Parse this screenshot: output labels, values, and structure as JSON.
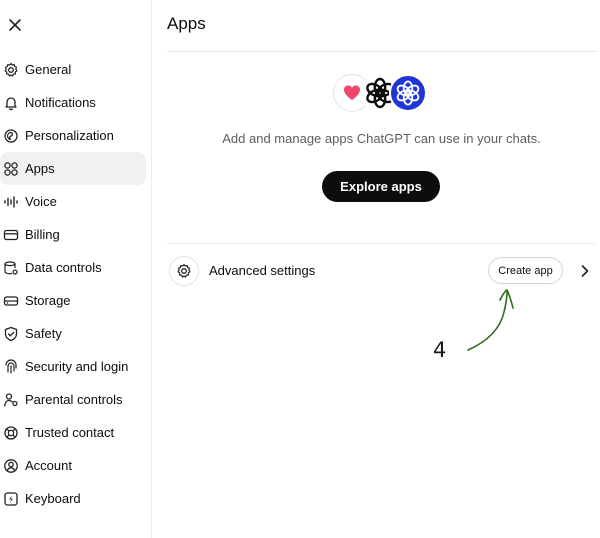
{
  "sidebar": {
    "items": [
      {
        "label": "General",
        "icon": "gear-icon"
      },
      {
        "label": "Notifications",
        "icon": "bell-icon"
      },
      {
        "label": "Personalization",
        "icon": "personalization-icon"
      },
      {
        "label": "Apps",
        "icon": "apps-grid-icon",
        "active": true
      },
      {
        "label": "Voice",
        "icon": "waveform-icon"
      },
      {
        "label": "Billing",
        "icon": "credit-card-icon"
      },
      {
        "label": "Data controls",
        "icon": "database-icon"
      },
      {
        "label": "Storage",
        "icon": "storage-icon"
      },
      {
        "label": "Safety",
        "icon": "shield-icon"
      },
      {
        "label": "Security and login",
        "icon": "fingerprint-icon"
      },
      {
        "label": "Parental controls",
        "icon": "parental-icon"
      },
      {
        "label": "Trusted contact",
        "icon": "lifebuoy-icon"
      },
      {
        "label": "Account",
        "icon": "user-circle-icon"
      },
      {
        "label": "Keyboard",
        "icon": "keyboard-icon"
      }
    ]
  },
  "main": {
    "title": "Apps",
    "subtitle": "Add and manage apps ChatGPT can use in your chats.",
    "explore_label": "Explore apps",
    "advanced_label": "Advanced settings",
    "create_label": "Create app",
    "annotation_number": "4"
  },
  "colors": {
    "accent_blue": "#1f35d6",
    "heart_pink": "#f2456b",
    "annotation_green": "#2e6b1e",
    "button_dark": "#0d0d0d"
  }
}
